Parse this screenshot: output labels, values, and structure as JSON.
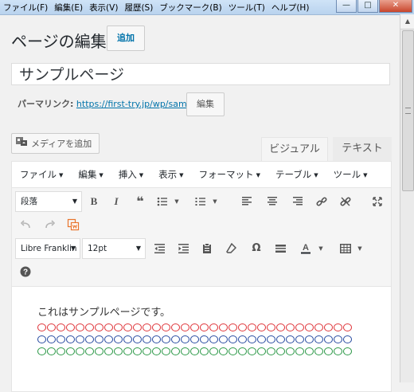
{
  "browser": {
    "menu": [
      "ファイル(F)",
      "編集(E)",
      "表示(V)",
      "履歴(S)",
      "ブックマーク(B)",
      "ツール(T)",
      "ヘルプ(H)"
    ],
    "min": "—",
    "max": "□",
    "close": "✕"
  },
  "header": {
    "title": "ページの編集",
    "add_new": "追加"
  },
  "post": {
    "title": "サンプルページ",
    "permalink_label": "パーマリンク:",
    "permalink_url": "https://first-try.jp/wp/sample/",
    "permalink_edit": "編集"
  },
  "media": {
    "add_media": "メディアを追加"
  },
  "editor_tabs": {
    "visual": "ビジュアル",
    "text": "テキスト"
  },
  "editor_menu": [
    "ファイル",
    "編集",
    "挿入",
    "表示",
    "フォーマット",
    "テーブル",
    "ツール"
  ],
  "toolbar": {
    "format_select": "段落",
    "font_select": "Libre Franklin",
    "size_select": "12pt",
    "bold": "B",
    "italic": "I",
    "quote": "❝",
    "omega": "Ω",
    "help": "?"
  },
  "content": {
    "text": "これはサンプルページです。",
    "circle_rows": [
      {
        "glyphs": "〇〇〇〇〇〇〇〇〇〇〇〇〇〇〇〇〇〇〇〇〇〇〇〇〇〇〇〇〇〇〇〇〇",
        "color": "#e0383d"
      },
      {
        "glyphs": "〇〇〇〇〇〇〇〇〇〇〇〇〇〇〇〇〇〇〇〇〇〇〇〇〇〇〇〇〇〇〇〇〇",
        "color": "#2c4fa3"
      },
      {
        "glyphs": "〇〇〇〇〇〇〇〇〇〇〇〇〇〇〇〇〇〇〇〇〇〇〇〇〇〇〇〇〇〇〇〇〇",
        "color": "#2f9a4a"
      }
    ]
  },
  "colors": {
    "link": "#0073aa",
    "undo_disabled": "#b5b5b5",
    "orange_icon": "#e8742c"
  }
}
